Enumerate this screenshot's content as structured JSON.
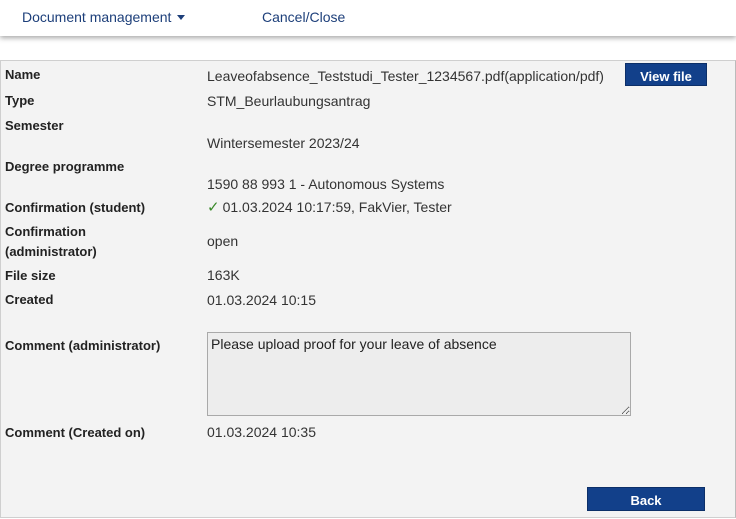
{
  "topbar": {
    "document_management": "Document management",
    "cancel_close": "Cancel/Close"
  },
  "details": {
    "name_label": "Name",
    "name_value": "Leaveofabsence_Teststudi_Tester_1234567.pdf(application/pdf)",
    "view_file": "View file",
    "type_label": "Type",
    "type_value": "STM_Beurlaubungsantrag",
    "semester_label": "Semester",
    "semester_value": "Wintersemester 2023/24",
    "degree_label": "Degree programme",
    "degree_value": "1590 88 993 1 - Autonomous Systems",
    "confirm_student_label": "Confirmation (student)",
    "confirm_student_value": "01.03.2024 10:17:59, FakVier, Tester",
    "confirm_admin_label_1": "Confirmation",
    "confirm_admin_label_2": "(administrator)",
    "confirm_admin_value": "open",
    "filesize_label": "File size",
    "filesize_value": "163K",
    "created_label": "Created",
    "created_value": "01.03.2024 10:15",
    "comment_admin_label": "Comment (administrator)",
    "comment_admin_value": "Please upload proof for your leave of absence",
    "comment_created_label": "Comment (Created on)",
    "comment_created_value": "01.03.2024 10:35",
    "back": "Back"
  }
}
